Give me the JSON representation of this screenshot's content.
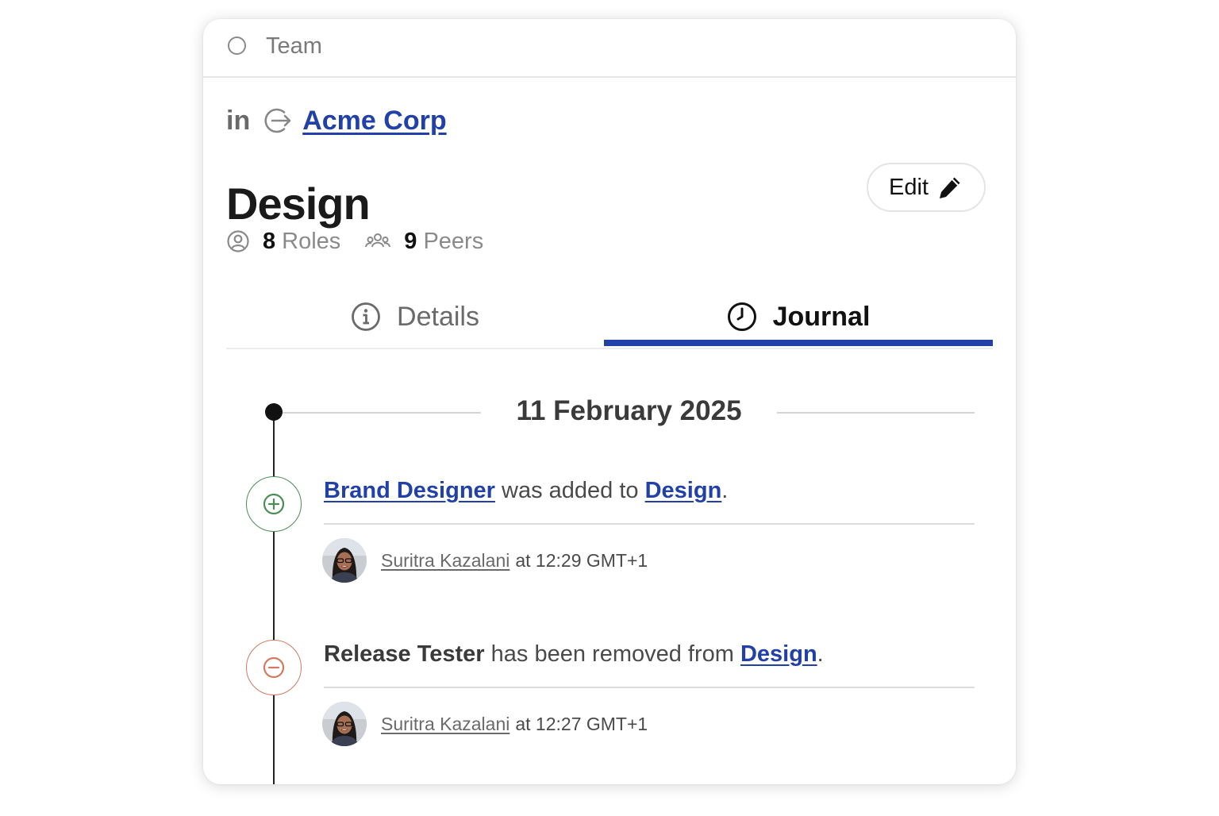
{
  "header": {
    "type_label": "Team"
  },
  "parent": {
    "prefix": "in",
    "name": "Acme Corp"
  },
  "team": {
    "title": "Design",
    "edit_label": "Edit",
    "roles_count": "8",
    "roles_label": "Roles",
    "peers_count": "9",
    "peers_label": "Peers"
  },
  "tabs": [
    {
      "label": "Details",
      "active": false,
      "icon": "info-icon"
    },
    {
      "label": "Journal",
      "active": true,
      "icon": "clock-icon"
    }
  ],
  "journal": {
    "date": "11 February 2025",
    "events": [
      {
        "type": "added",
        "icon": "plus-circle-icon",
        "subject": "Brand Designer",
        "verb": " was added to ",
        "target": "Design",
        "end": ".",
        "author": "Suritra Kazalani",
        "time": "at 12:29 GMT+1"
      },
      {
        "type": "removed",
        "icon": "minus-circle-icon",
        "subject": "Release Tester",
        "verb": " has been removed from ",
        "target": "Design",
        "end": ".",
        "author": "Suritra Kazalani",
        "time": "at 12:27 GMT+1"
      }
    ]
  },
  "colors": {
    "link": "#2141a8",
    "added": "#4b8e55",
    "removed": "#d17a5f",
    "active_tab": "#2141a8"
  }
}
